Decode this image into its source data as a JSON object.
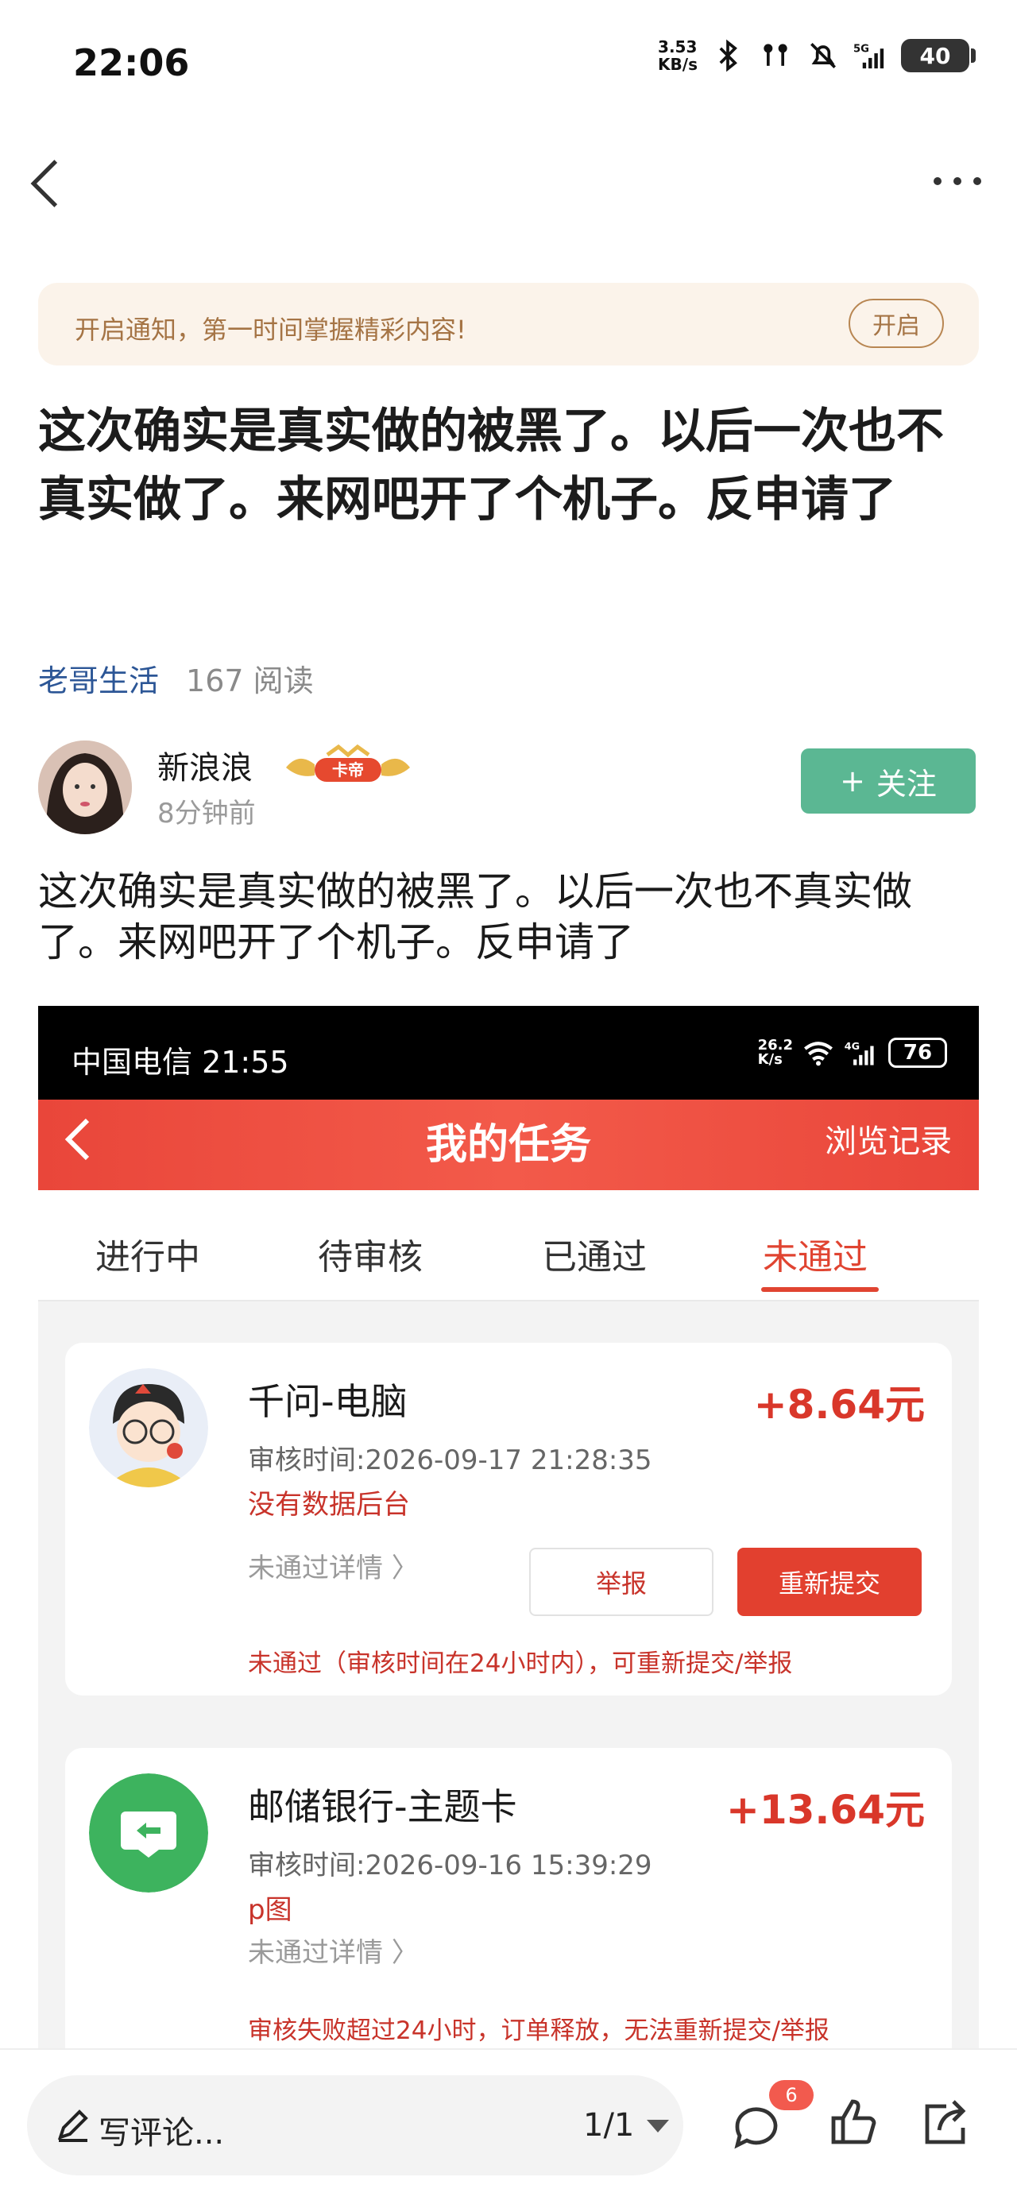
{
  "status_bar": {
    "time": "22:06",
    "net_speed_value": "3.53",
    "net_speed_unit": "KB/s",
    "network": "5G",
    "battery": "40"
  },
  "notify": {
    "text": "开启通知，第一时间掌握精彩内容!",
    "button": "开启"
  },
  "article": {
    "title": "这次确实是真实做的被黑了。以后一次也不真实做了。来网吧开了个机子。反申请了",
    "source": "老哥生活",
    "reads": "167 阅读",
    "author": "新浪浪",
    "badge": "卡帝",
    "post_time": "8分钟前",
    "follow_label": "关注",
    "body": "这次确实是真实做的被黑了。以后一次也不真实做了。来网吧开了个机子。反申请了"
  },
  "embedded": {
    "carrier_time": "中国电信 21:55",
    "net_speed_value": "26.2",
    "net_speed_unit": "K/s",
    "network": "4G",
    "battery": "76",
    "header_title": "我的任务",
    "header_right": "浏览记录",
    "tabs": [
      "进行中",
      "待审核",
      "已通过",
      "未通过"
    ],
    "cards": [
      {
        "name": "千问-电脑",
        "amount": "+8.64元",
        "time": "审核时间:2026-09-17 21:28:35",
        "reason": "没有数据后台",
        "detail": "未通过详情 〉",
        "report": "举报",
        "resubmit": "重新提交",
        "note": "未通过（审核时间在24小时内），可重新提交/举报"
      },
      {
        "name": "邮储银行-主题卡",
        "amount": "+13.64元",
        "time": "审核时间:2026-09-16 15:39:29",
        "reason": "p图",
        "detail": "未通过详情 〉",
        "note": "审核失败超过24小时，订单释放，无法重新提交/举报"
      }
    ]
  },
  "bottom": {
    "comment_placeholder": "写评论...",
    "page_indicator": "1/1",
    "comment_count": "6"
  },
  "colors": {
    "accent_red": "#e2402f",
    "follow_green": "#5bb793",
    "link_blue": "#2c5696"
  }
}
